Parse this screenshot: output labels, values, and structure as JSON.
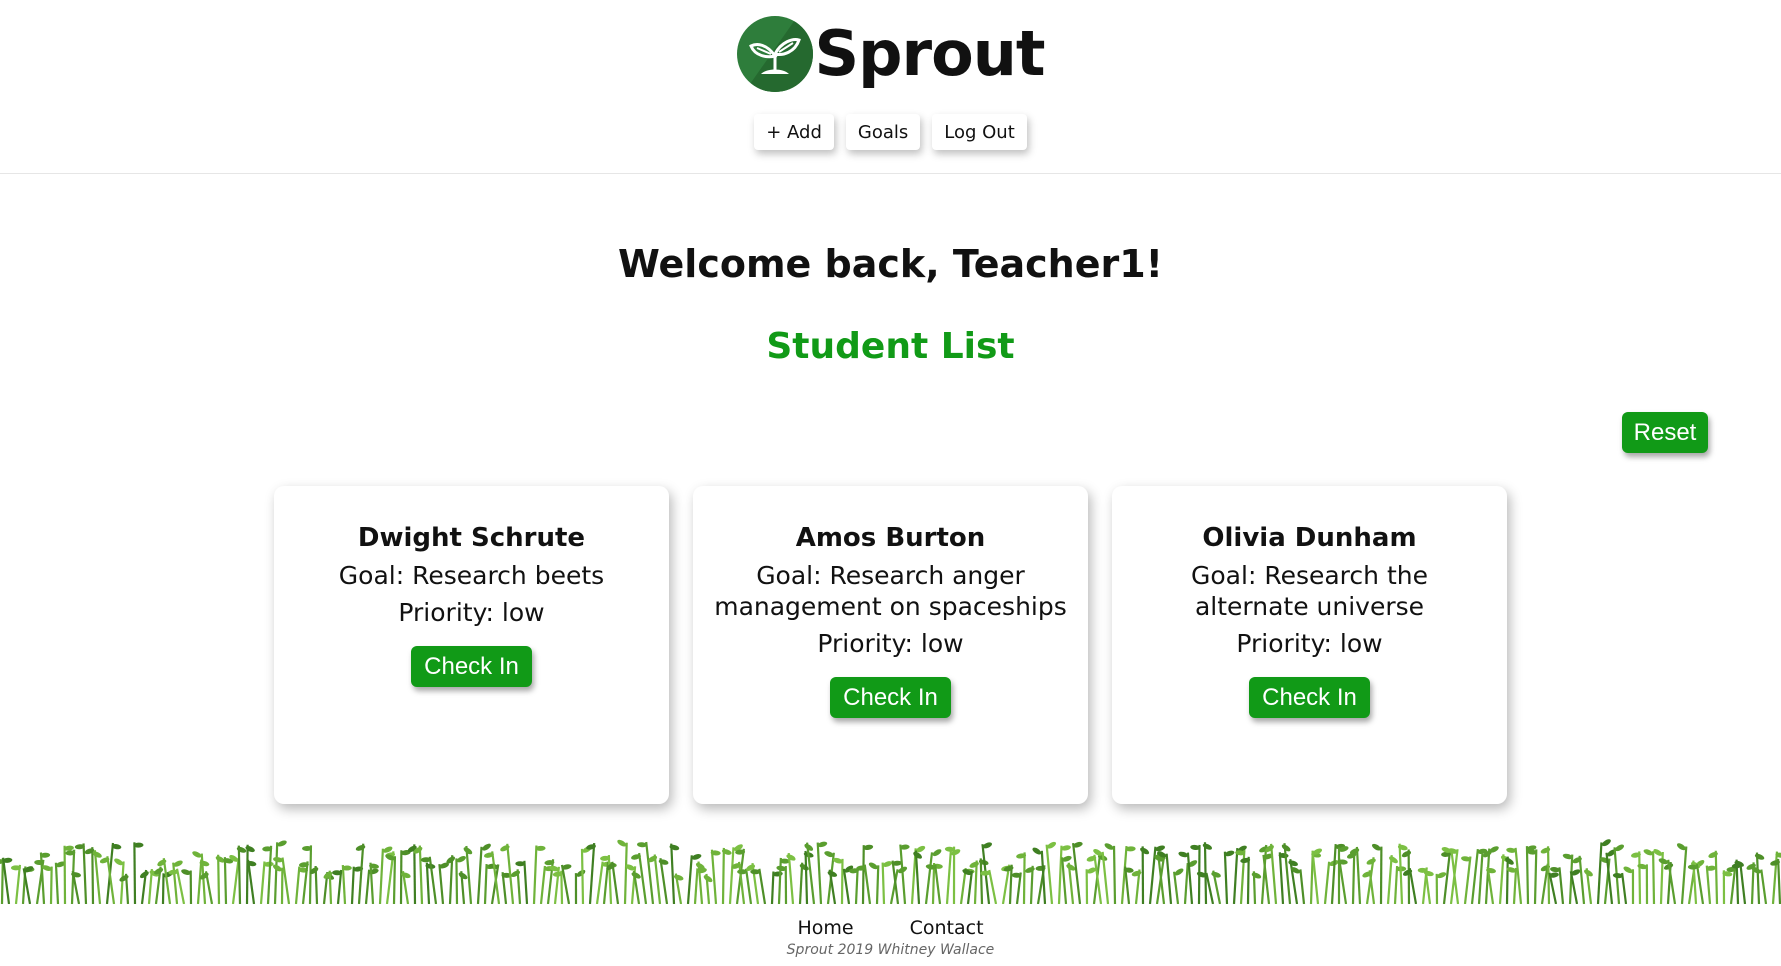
{
  "brand": {
    "name": "Sprout",
    "logo_icon": "sprout-icon",
    "logo_color": "#2e7d3b"
  },
  "nav": {
    "add_label": "+ Add",
    "goals_label": "Goals",
    "logout_label": "Log Out"
  },
  "main": {
    "welcome": "Welcome back, Teacher1!",
    "list_title": "Student List",
    "reset_label": "Reset",
    "accent_color": "#119a17"
  },
  "students": [
    {
      "name": "Dwight Schrute",
      "goal": "Goal: Research beets",
      "priority": "Priority: low",
      "action": "Check In"
    },
    {
      "name": "Amos Burton",
      "goal": "Goal: Research anger management on spaceships",
      "priority": "Priority: low",
      "action": "Check In"
    },
    {
      "name": "Olivia Dunham",
      "goal": "Goal: Research the alternate universe",
      "priority": "Priority: low",
      "action": "Check In"
    }
  ],
  "footer": {
    "home_label": "Home",
    "contact_label": "Contact",
    "copyright": "Sprout 2019 Whitney Wallace"
  }
}
